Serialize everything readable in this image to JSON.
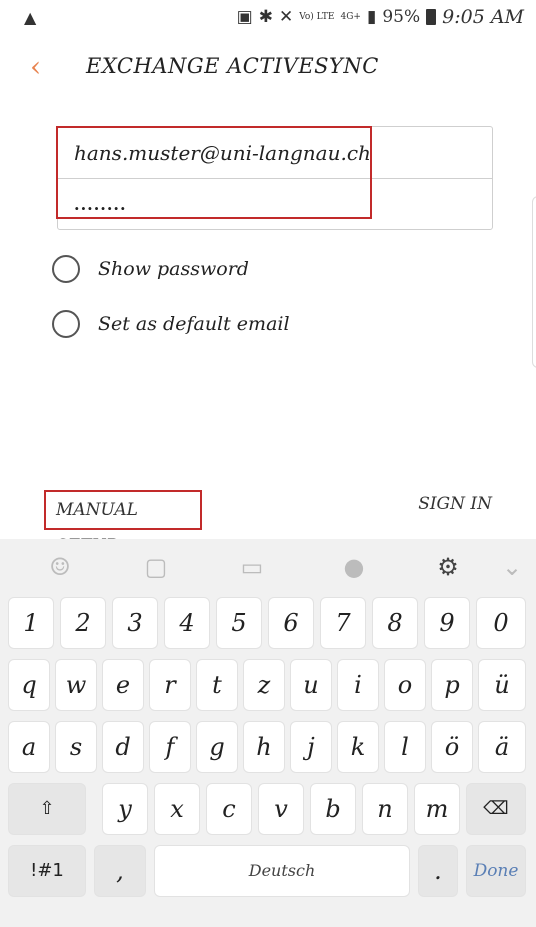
{
  "status_bar": {
    "notification_icon": "bell-icon",
    "volte": "Vo) LTE",
    "network": "4G+",
    "battery": "95%",
    "time": "9:05 AM"
  },
  "header": {
    "title": "EXCHANGE ACTIVESYNC",
    "back_icon": "chevron-left-icon"
  },
  "form": {
    "email_value": "hans.muster@uni-langnau.ch",
    "password_value": "........",
    "show_password_label": "Show password",
    "default_email_label": "Set as default email"
  },
  "actions": {
    "manual_setup_label": "MANUAL SETUP",
    "sign_in_label": "SIGN IN"
  },
  "keyboard": {
    "row1": [
      "1",
      "2",
      "3",
      "4",
      "5",
      "6",
      "7",
      "8",
      "9",
      "0"
    ],
    "row2": [
      "q",
      "w",
      "e",
      "r",
      "t",
      "z",
      "u",
      "i",
      "o",
      "p",
      "ü"
    ],
    "row3": [
      "a",
      "s",
      "d",
      "f",
      "g",
      "h",
      "j",
      "k",
      "l",
      "ö",
      "ä"
    ],
    "row4": [
      "y",
      "x",
      "c",
      "v",
      "b",
      "n",
      "m"
    ],
    "symbols_label": "!#1",
    "comma": ",",
    "space_label": "Deutsch",
    "period": ".",
    "done_label": "Done"
  },
  "colors": {
    "accent": "#e8834f",
    "highlight": "#c22a2a",
    "done": "#5a7fb5"
  }
}
